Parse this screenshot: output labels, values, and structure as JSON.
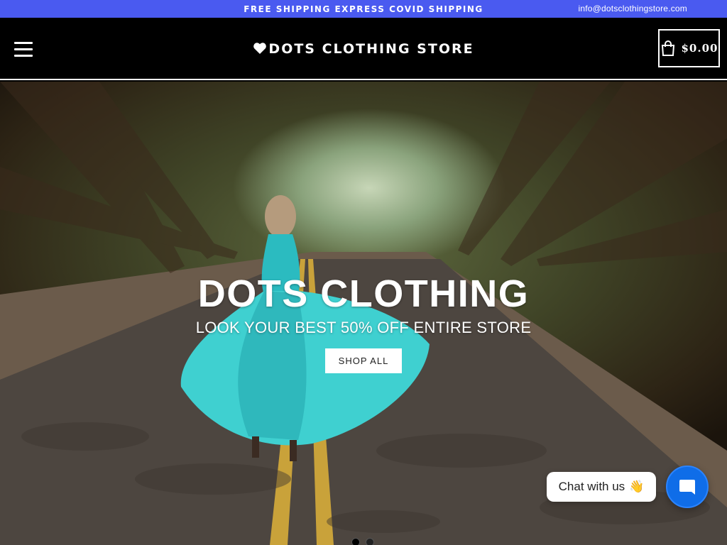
{
  "announcement": {
    "promo_text": "FREE SHIPPING EXPRESS COVID SHIPPING",
    "email": "info@dotsclothingstore.com"
  },
  "header": {
    "menu_icon": "hamburger-menu-icon",
    "logo_icon": "heart-icon",
    "logo_text": "DOTS CLOTHING STORE",
    "cart_icon": "shopping-bag-icon",
    "cart_total": "$0.00"
  },
  "hero": {
    "title": "DOTS CLOTHING",
    "subtitle": "LOOK YOUR BEST 50% OFF ENTIRE STORE",
    "button_label": "SHOP ALL",
    "slide_count": 2,
    "active_slide": 1
  },
  "chat": {
    "label": "Chat with us",
    "emoji": "👋",
    "launcher_icon": "chat-icon"
  },
  "colors": {
    "announcement_bg": "#4a5af0",
    "header_bg": "#000000",
    "chat_launcher": "#0f6de8"
  }
}
